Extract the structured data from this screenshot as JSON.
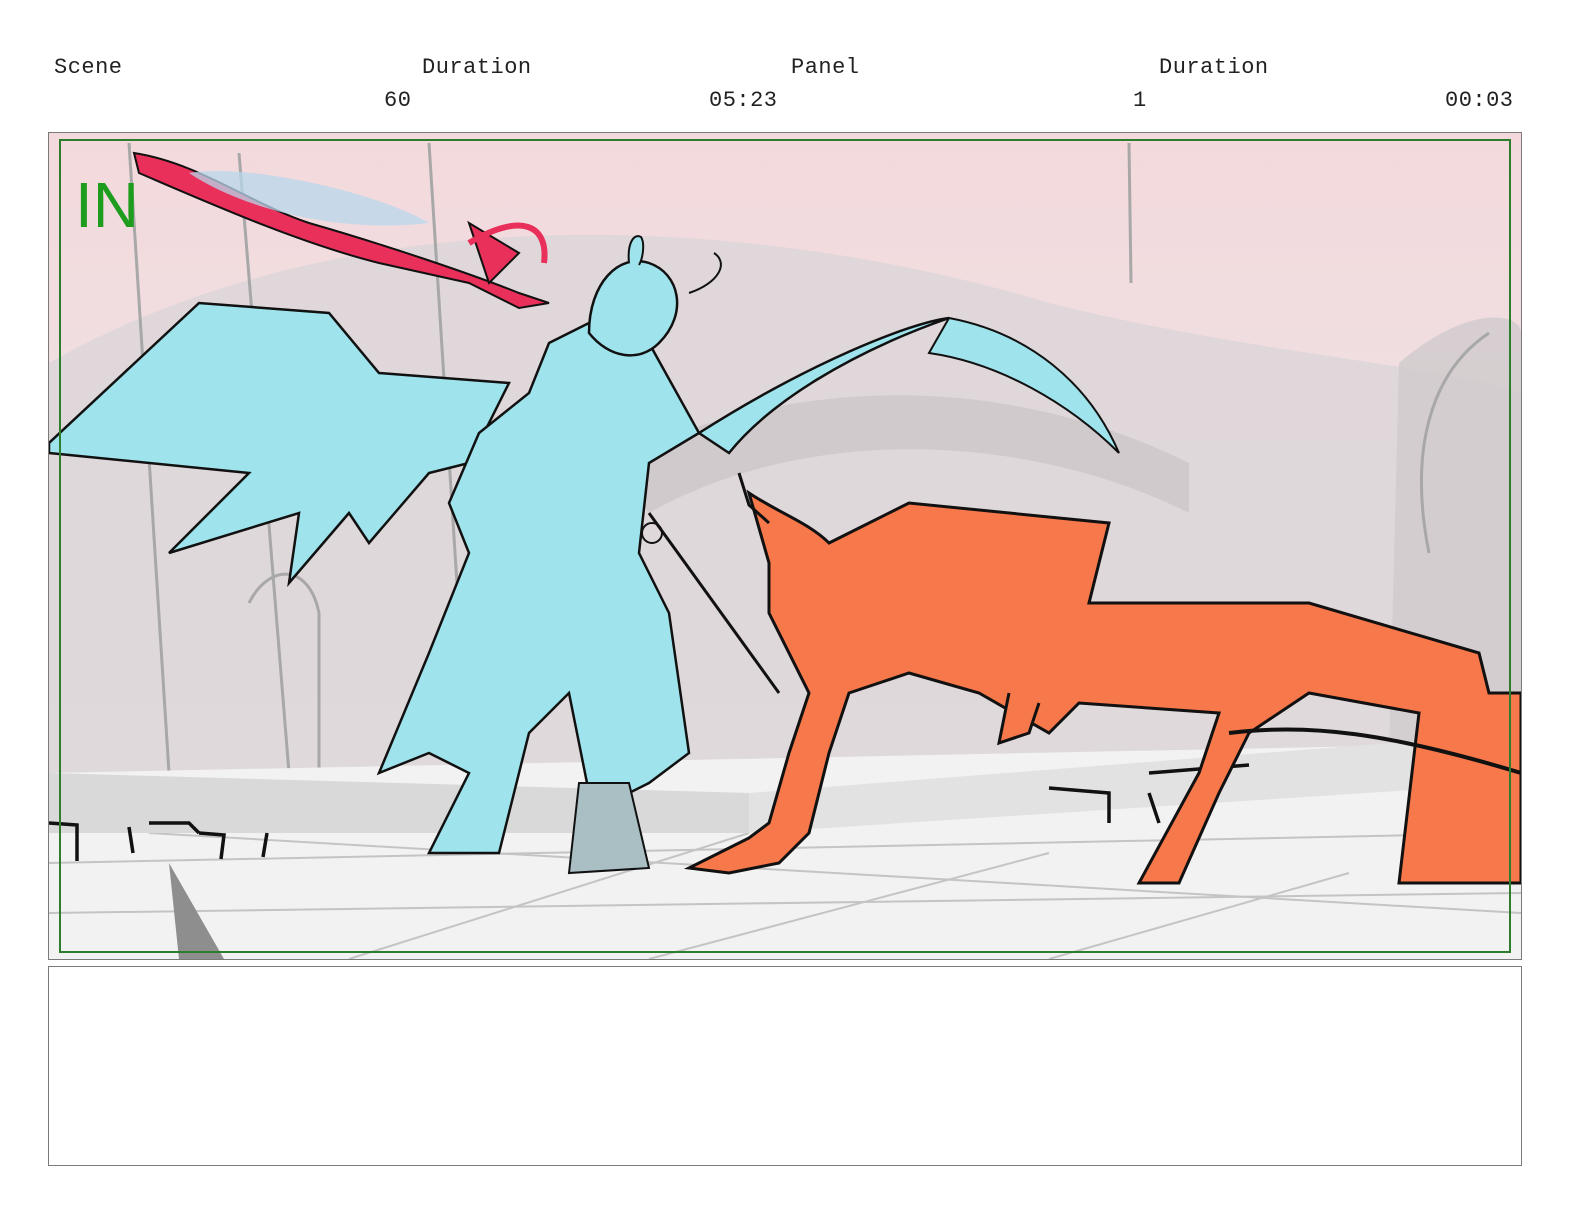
{
  "header": {
    "scene_label": "Scene",
    "scene_duration_label": "Duration",
    "panel_label": "Panel",
    "panel_duration_label": "Duration",
    "scene_value": "60",
    "scene_duration_value": "05:23",
    "panel_value": "1",
    "panel_duration_value": "00:03"
  },
  "panel": {
    "marker": "IN",
    "marker_color": "#1e9c1e",
    "safe_frame_color": "#2e7d2e",
    "fig_left_color": "#9fe3ec",
    "fig_right_color": "#f7784a",
    "spear_color": "#e8305a",
    "sky_color": "#f4dadd"
  },
  "notes": {
    "text": ""
  }
}
